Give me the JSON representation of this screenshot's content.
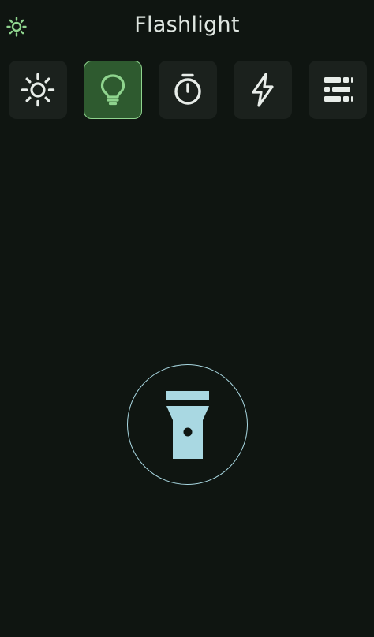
{
  "app": {
    "title": "Flashlight"
  },
  "header": {
    "settings_icon": "sun-small-icon"
  },
  "modes": [
    {
      "id": "brightness",
      "icon": "sun-icon",
      "active": false
    },
    {
      "id": "bulb",
      "icon": "lightbulb-icon",
      "active": true
    },
    {
      "id": "timer",
      "icon": "stopwatch-icon",
      "active": false
    },
    {
      "id": "strobe",
      "icon": "lightning-icon",
      "active": false
    },
    {
      "id": "morse",
      "icon": "morse-code-icon",
      "active": false
    }
  ],
  "power": {
    "icon": "flashlight-icon"
  },
  "colors": {
    "background": "#0f1511",
    "tile": "#1b211d",
    "active_tile": "#2e5a2f",
    "accent_green": "#8fd48e",
    "icon_light": "#e8ede9",
    "power_accent": "#a9d8e2"
  }
}
